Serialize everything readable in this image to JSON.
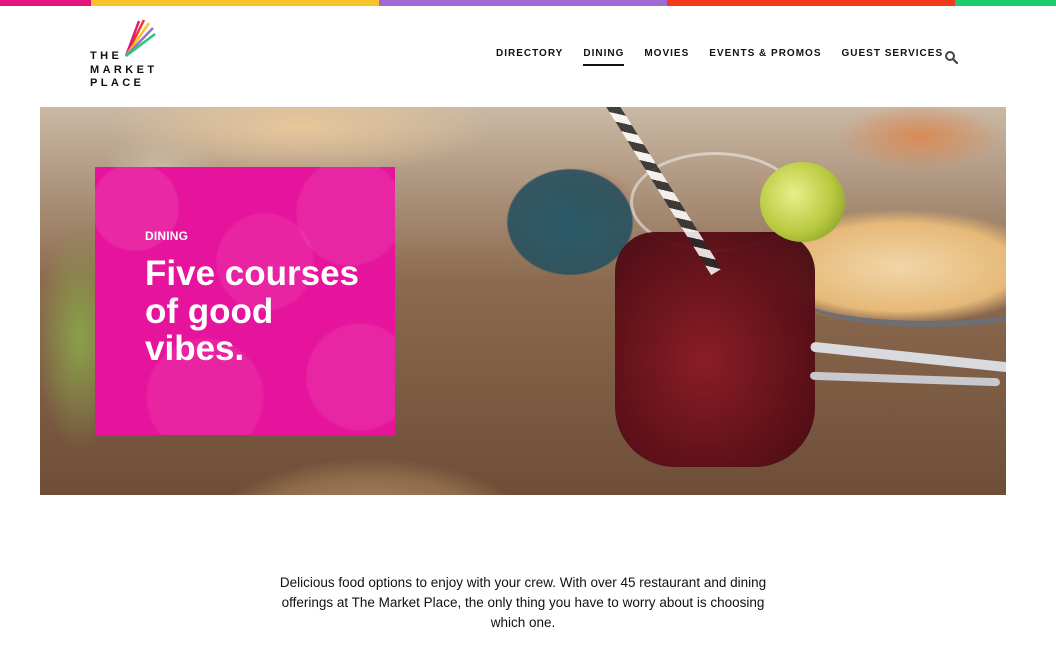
{
  "topbar": {
    "colors": [
      "#e2157e",
      "#f7c52b",
      "#9f6ad5",
      "#f23a1c",
      "#1fcc6b"
    ]
  },
  "logo": {
    "lines": [
      "THE",
      "MARKET",
      "PLACE"
    ],
    "icon": "colorful-rays-icon"
  },
  "nav": {
    "items": [
      {
        "label": "DIRECTORY",
        "active": false
      },
      {
        "label": "DINING",
        "active": true
      },
      {
        "label": "MOVIES",
        "active": false
      },
      {
        "label": "EVENTS & PROMOS",
        "active": false
      },
      {
        "label": "GUEST SERVICES",
        "active": false
      }
    ],
    "search_icon": "search-icon"
  },
  "hero": {
    "tag": "DINING",
    "title": "Five courses of good vibes.",
    "card_color": "#e6139c"
  },
  "intro": {
    "text": "Delicious food options to enjoy with your crew. With over 45 restaurant and dining offerings at The Market Place, the only thing you have to worry about is choosing which one."
  }
}
